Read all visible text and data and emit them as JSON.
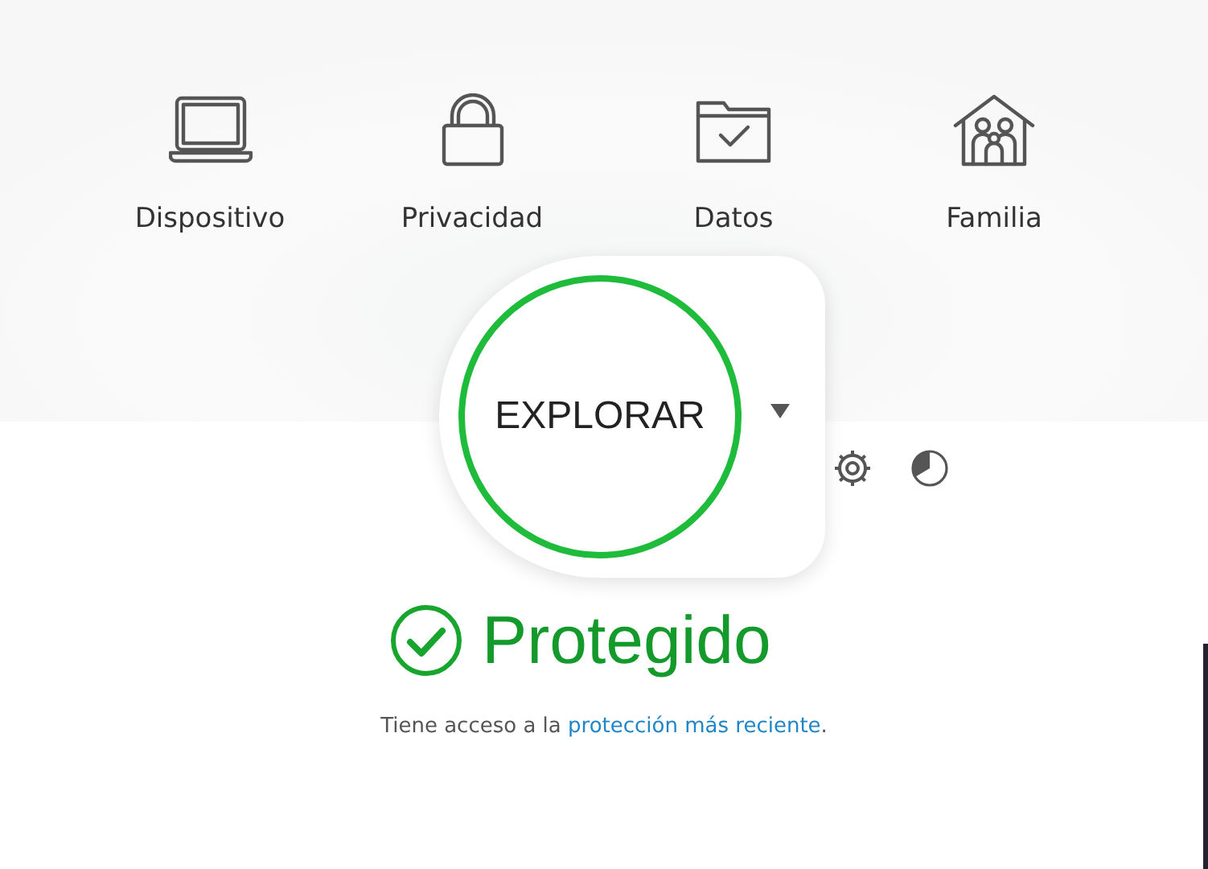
{
  "categories": [
    {
      "kind": "device",
      "label": "Dispositivo"
    },
    {
      "kind": "privacy",
      "label": "Privacidad"
    },
    {
      "kind": "data",
      "label": "Datos"
    },
    {
      "kind": "family",
      "label": "Familia"
    }
  ],
  "scan": {
    "label": "EXPLORAR"
  },
  "status": {
    "title": "Protegido",
    "message_before": "Tiene acceso a la ",
    "link": "protección más reciente",
    "message_after": "."
  }
}
